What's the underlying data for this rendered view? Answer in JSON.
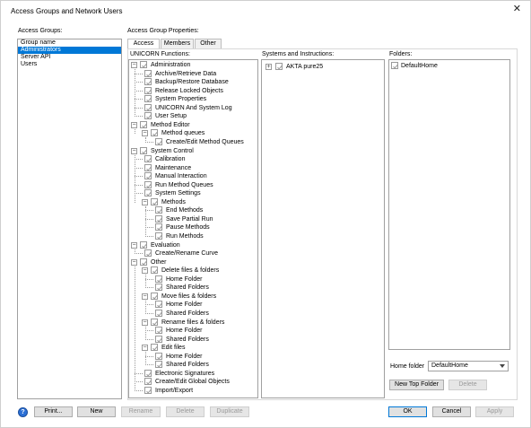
{
  "window": {
    "title": "Access Groups and Network Users"
  },
  "groups": {
    "label": "Access Groups:",
    "items": [
      "Group name",
      "Administrators",
      "Server API",
      "Users"
    ],
    "selected_index": 1
  },
  "properties": {
    "label": "Access Group Properties:",
    "tabs": [
      "Access",
      "Members",
      "Other"
    ],
    "active_tab": 0,
    "functions_label": "UNICORN Functions:",
    "systems_label": "Systems and Instructions:",
    "folders_label": "Folders:"
  },
  "functions": [
    {
      "label": "Administration",
      "level": 0,
      "expandable": true
    },
    {
      "label": "Archive/Retrieve Data",
      "level": 1
    },
    {
      "label": "Backup/Restore Database",
      "level": 1
    },
    {
      "label": "Release Locked Objects",
      "level": 1
    },
    {
      "label": "System Properties",
      "level": 1
    },
    {
      "label": "UNICORN And System Log",
      "level": 1
    },
    {
      "label": "User Setup",
      "level": 1
    },
    {
      "label": "Method Editor",
      "level": 0,
      "expandable": true
    },
    {
      "label": "Method queues",
      "level": 1,
      "expandable": true
    },
    {
      "label": "Create/Edit Method Queues",
      "level": 2
    },
    {
      "label": "System Control",
      "level": 0,
      "expandable": true
    },
    {
      "label": "Calibration",
      "level": 1
    },
    {
      "label": "Maintenance",
      "level": 1
    },
    {
      "label": "Manual Interaction",
      "level": 1
    },
    {
      "label": "Run Method Queues",
      "level": 1
    },
    {
      "label": "System Settings",
      "level": 1
    },
    {
      "label": "Methods",
      "level": 1,
      "expandable": true
    },
    {
      "label": "End Methods",
      "level": 2
    },
    {
      "label": "Save Partial Run",
      "level": 2
    },
    {
      "label": "Pause Methods",
      "level": 2
    },
    {
      "label": "Run Methods",
      "level": 2
    },
    {
      "label": "Evaluation",
      "level": 0,
      "expandable": true
    },
    {
      "label": "Create/Rename Curve",
      "level": 1
    },
    {
      "label": "Other",
      "level": 0,
      "expandable": true
    },
    {
      "label": "Delete files & folders",
      "level": 1,
      "expandable": true
    },
    {
      "label": "Home Folder",
      "level": 2
    },
    {
      "label": "Shared Folders",
      "level": 2
    },
    {
      "label": "Move files & folders",
      "level": 1,
      "expandable": true
    },
    {
      "label": "Home Folder",
      "level": 2
    },
    {
      "label": "Shared Folders",
      "level": 2
    },
    {
      "label": "Rename files & folders",
      "level": 1,
      "expandable": true
    },
    {
      "label": "Home Folder",
      "level": 2
    },
    {
      "label": "Shared Folders",
      "level": 2
    },
    {
      "label": "Edit files",
      "level": 1,
      "expandable": true
    },
    {
      "label": "Home Folder",
      "level": 2
    },
    {
      "label": "Shared Folders",
      "level": 2
    },
    {
      "label": "Electronic Signatures",
      "level": 1
    },
    {
      "label": "Create/Edit Global Objects",
      "level": 1
    },
    {
      "label": "Import/Export",
      "level": 1
    }
  ],
  "systems": [
    {
      "label": "AKTA pure25",
      "expandable": true
    }
  ],
  "folders": [
    {
      "label": "DefaultHome"
    }
  ],
  "home_folder": {
    "label": "Home folder",
    "value": "DefaultHome"
  },
  "buttons": {
    "new_top_folder": "New Top Folder",
    "delete_folder": "Delete",
    "print": "Print...",
    "new": "New",
    "rename": "Rename",
    "delete": "Delete",
    "duplicate": "Duplicate",
    "ok": "OK",
    "cancel": "Cancel",
    "apply": "Apply"
  },
  "icons": {
    "close": "close-icon",
    "help": "help-icon",
    "check": "check-icon"
  },
  "colors": {
    "selection": "#0078d7",
    "check": "#9a9a9a"
  }
}
